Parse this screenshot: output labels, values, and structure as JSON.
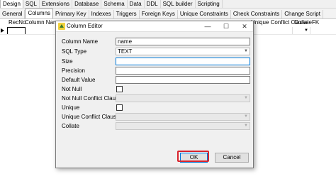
{
  "top_tabs": [
    "Design",
    "SQL",
    "Extensions",
    "Database",
    "Schema",
    "Data",
    "DDL",
    "SQL builder",
    "Scripting"
  ],
  "sub_tabs": [
    "General",
    "Columns",
    "Primary Key",
    "Indexes",
    "Triggers",
    "Foreign Keys",
    "Unique Constraints",
    "Check Constraints",
    "Change Script"
  ],
  "grid": {
    "col_recno": "RecNo",
    "col_column_name": "Column Name",
    "col_unique_conflict": "Unique Conflict Clause",
    "col_collate": "Collate",
    "col_fk": "FK"
  },
  "dialog": {
    "title": "Column Editor",
    "minimize": "—",
    "maximize": "☐",
    "close": "✕",
    "labels": {
      "column_name": "Column Name",
      "sql_type": "SQL Type",
      "size": "Size",
      "precision": "Precision",
      "default_value": "Default Value",
      "not_null": "Not Null",
      "not_null_conflict": "Not Null Conflict Clause",
      "unique": "Unique",
      "unique_conflict": "Unique Conflict Clause",
      "collate": "Collate"
    },
    "values": {
      "column_name": "name",
      "sql_type": "TEXT",
      "size": "",
      "precision": "",
      "default_value": ""
    },
    "ok_label": "OK",
    "cancel_label": "Cancel"
  },
  "colors": {
    "highlight": "#d9232d",
    "focus": "#0078d7"
  }
}
